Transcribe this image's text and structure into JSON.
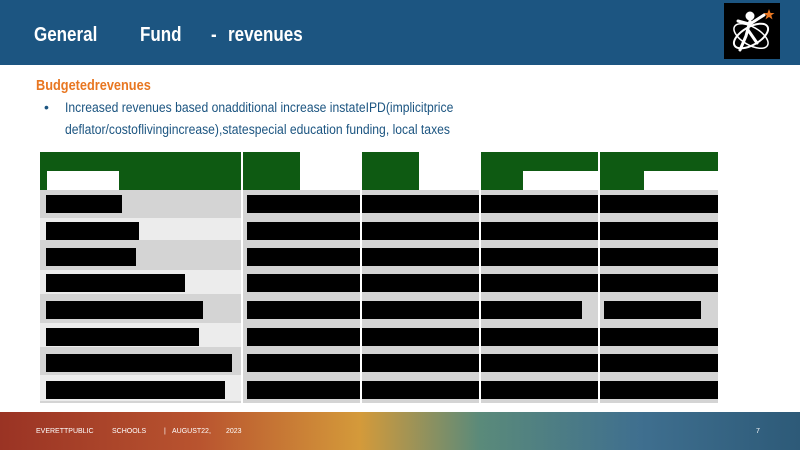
{
  "header": {
    "title_parts": [
      "General",
      "Fund",
      "-",
      "revenues"
    ],
    "logo_icon": "school-district-logo-icon"
  },
  "content": {
    "subheading": "Budgetedrevenues",
    "bullet_line1": "Increased      revenues      based    onadditional        increase     instateIPD(implicitprice",
    "bullet_line2": "deflator/costoflivingincrease),statespecial                    education       funding,        local     taxes"
  },
  "footer": {
    "org1": "EVERETTPUBLIC",
    "org2": "SCHOOLS",
    "separator": "|",
    "date": "AUGUST22,",
    "year": "2023",
    "page": "7"
  },
  "colors": {
    "header_bg": "#1c5581",
    "accent": "#e87722",
    "table_header": "#0e5a12"
  }
}
